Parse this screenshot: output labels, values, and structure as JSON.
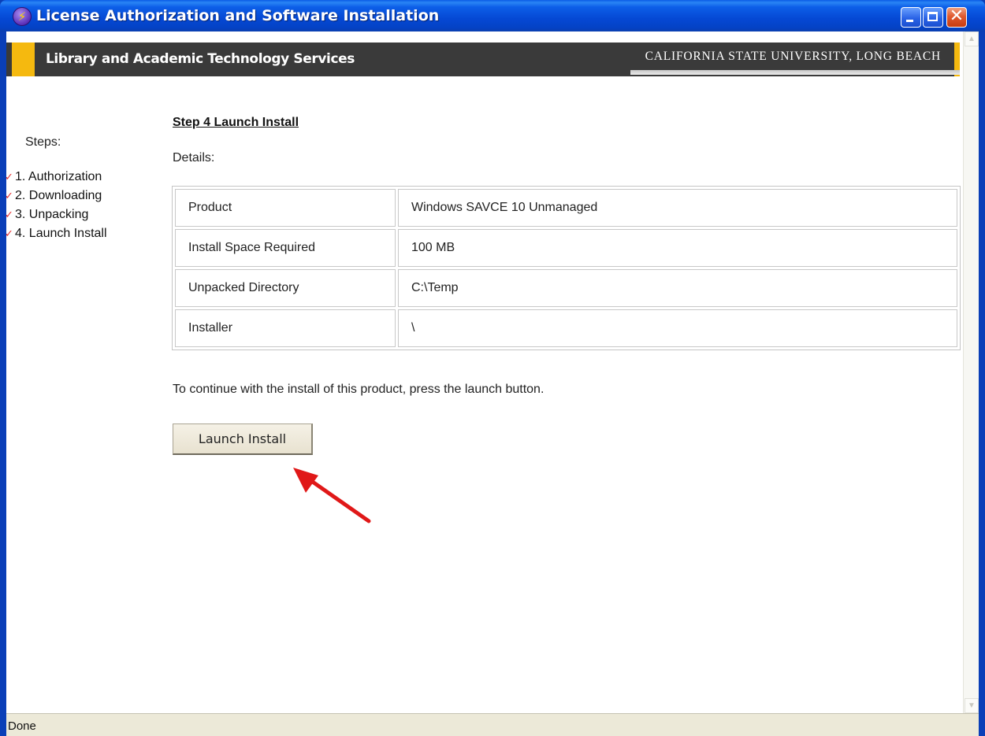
{
  "window": {
    "title": "License Authorization and Software Installation",
    "app_icon": "lightning-icon"
  },
  "banner": {
    "left_text": "Library and Academic Technology Services",
    "right_text": "CALIFORNIA STATE UNIVERSITY, LONG BEACH",
    "accent_color": "#f5b90f",
    "background_color": "#3a3a3a"
  },
  "sidebar": {
    "label": "Steps:",
    "steps": [
      {
        "label": "1. Authorization",
        "done": true
      },
      {
        "label": "2. Downloading",
        "done": true
      },
      {
        "label": "3. Unpacking",
        "done": true
      },
      {
        "label": "4. Launch Install",
        "done": true
      }
    ]
  },
  "main": {
    "step_title": "Step 4 Launch Install",
    "details_label": "Details:",
    "details": [
      {
        "key": "Product",
        "value": "Windows SAVCE 10 Unmanaged"
      },
      {
        "key": "Install Space Required",
        "value": "100 MB"
      },
      {
        "key": "Unpacked Directory",
        "value": "C:\\Temp"
      },
      {
        "key": "Installer",
        "value": "\\"
      }
    ],
    "instruction": "To continue with the install of this product, press the launch button.",
    "launch_button": "Launch Install"
  },
  "status": {
    "text": "Done"
  },
  "colors": {
    "check": "#e53030",
    "annotation_arrow": "#e01818"
  }
}
